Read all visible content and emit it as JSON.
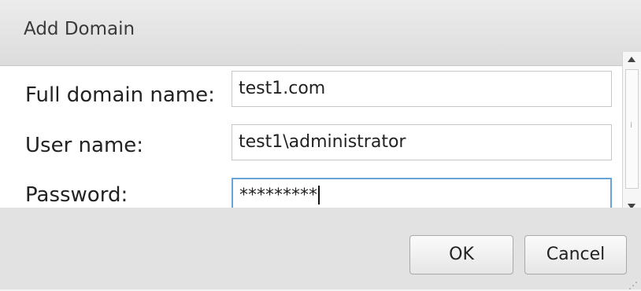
{
  "dialog": {
    "title": "Add Domain"
  },
  "form": {
    "fields": [
      {
        "label": "Full domain name:",
        "value": "test1.com"
      },
      {
        "label": "User name:",
        "value": "test1\\administrator"
      },
      {
        "label": "Password:",
        "value": "*********"
      }
    ]
  },
  "buttons": {
    "ok": "OK",
    "cancel": "Cancel"
  },
  "colors": {
    "focus_border": "#67a3d6",
    "footer_bg": "#e2e2e2",
    "titlebar_bg": "#dcdcdc"
  },
  "icons": {
    "scroll_up": "scroll-up-arrow-icon",
    "scroll_down": "scroll-down-arrow-icon",
    "resize": "resize-grip-icon"
  }
}
